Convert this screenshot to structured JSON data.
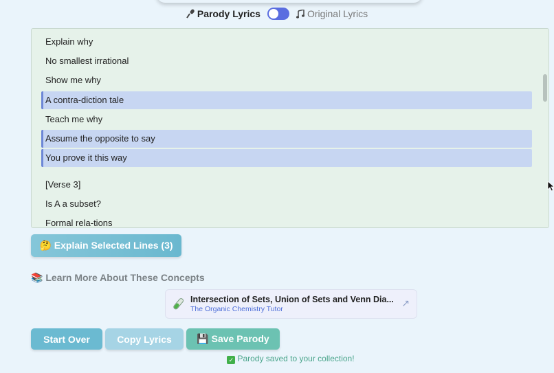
{
  "toggle": {
    "parody_label": "Parody Lyrics",
    "parody_icon": "microphone-icon",
    "original_label": "Original Lyrics",
    "original_icon": "music-note-icon",
    "state": "parody"
  },
  "lyrics": {
    "lines": [
      {
        "text": "Explain why",
        "selected": false
      },
      {
        "text": "No smallest irrational",
        "selected": false
      },
      {
        "text": "Show me why",
        "selected": false
      },
      {
        "text": "A contra-diction tale",
        "selected": true
      },
      {
        "text": "Teach me why",
        "selected": false
      },
      {
        "text": "Assume the opposite to say",
        "selected": true
      },
      {
        "text": "You prove it this way",
        "selected": true
      },
      {
        "text": "[Verse 3]",
        "selected": false
      },
      {
        "text": "Is A a subset?",
        "selected": false
      },
      {
        "text": "Formal rela-tions",
        "selected": false
      }
    ]
  },
  "actions": {
    "explain_label": "🤔 Explain Selected Lines (3)"
  },
  "concepts": {
    "heading": "📚 Learn More About These Concepts",
    "video": {
      "title": "Intersection of Sets, Union of Sets and Venn Dia...",
      "channel": "The Organic Chemistry Tutor",
      "icon": "test-tube-icon",
      "link_icon": "external-link-icon"
    }
  },
  "footer": {
    "start_over": "Start Over",
    "copy_lyrics": "Copy Lyrics",
    "save_parody": "💾 Save Parody",
    "saved_message": "Parody saved to your collection!"
  },
  "colors": {
    "selected_bg": "#c7d6f2",
    "toggle_on": "#5a6de0",
    "accent_green": "#6cc2b2"
  }
}
